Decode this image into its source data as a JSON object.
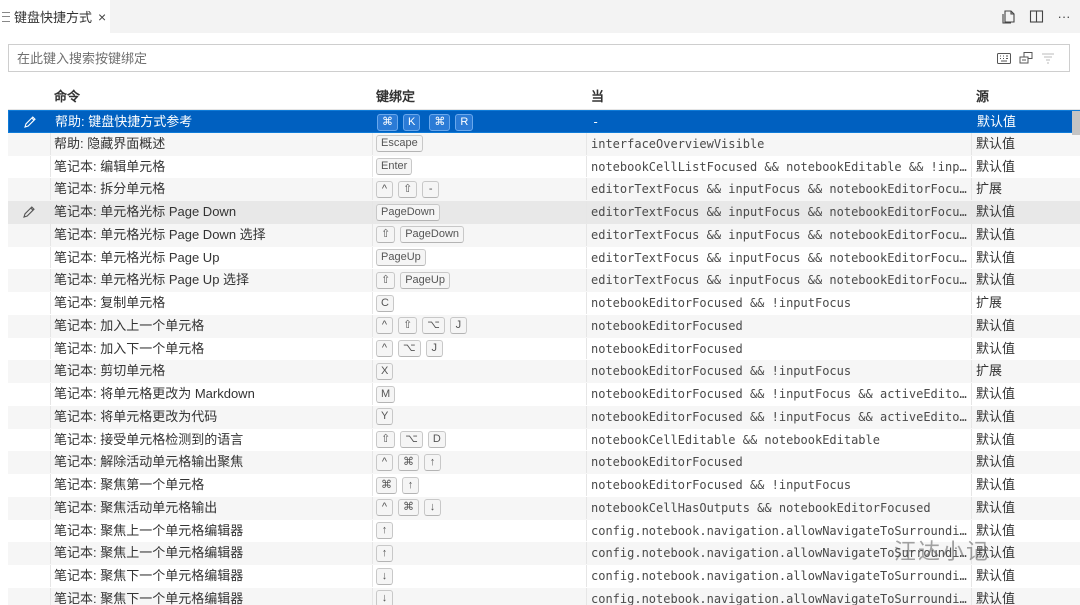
{
  "tab": {
    "title": "键盘快捷方式",
    "close": "×"
  },
  "tab_actions": {
    "more": "···"
  },
  "search": {
    "placeholder": "在此键入搜索按键绑定"
  },
  "columns": {
    "command": "命令",
    "keybinding": "键绑定",
    "when": "当",
    "source": "源"
  },
  "rows": [
    {
      "command": "帮助: 键盘快捷方式参考",
      "keys": [
        "⌘",
        "K",
        "|",
        "⌘",
        "R"
      ],
      "when": "-",
      "source": "默认值",
      "selected": true,
      "edit": true
    },
    {
      "command": "帮助: 隐藏界面概述",
      "keys": [
        "Escape"
      ],
      "when": "interfaceOverviewVisible",
      "source": "默认值"
    },
    {
      "command": "笔记本: 编辑单元格",
      "keys": [
        "Enter"
      ],
      "when": "notebookCellListFocused && notebookEditable && !inputFo…",
      "source": "默认值"
    },
    {
      "command": "笔记本: 拆分单元格",
      "keys": [
        "^",
        "⇧",
        "-"
      ],
      "when": "editorTextFocus && inputFocus && notebookEditorFocused",
      "source": "扩展"
    },
    {
      "command": "笔记本: 单元格光标 Page Down",
      "keys": [
        "PageDown"
      ],
      "when": "editorTextFocus && inputFocus && notebookEditorFocused",
      "source": "默认值",
      "hover": true,
      "edit": true
    },
    {
      "command": "笔记本: 单元格光标 Page Down 选择",
      "keys": [
        "⇧",
        "PageDown"
      ],
      "when": "editorTextFocus && inputFocus && notebookEditorFocused",
      "source": "默认值"
    },
    {
      "command": "笔记本: 单元格光标 Page Up",
      "keys": [
        "PageUp"
      ],
      "when": "editorTextFocus && inputFocus && notebookEditorFocused",
      "source": "默认值"
    },
    {
      "command": "笔记本: 单元格光标 Page Up 选择",
      "keys": [
        "⇧",
        "PageUp"
      ],
      "when": "editorTextFocus && inputFocus && notebookEditorFocused",
      "source": "默认值"
    },
    {
      "command": "笔记本: 复制单元格",
      "keys": [
        "C"
      ],
      "when": "notebookEditorFocused && !inputFocus",
      "source": "扩展"
    },
    {
      "command": "笔记本: 加入上一个单元格",
      "keys": [
        "^",
        "⇧",
        "⌥",
        "J"
      ],
      "when": "notebookEditorFocused",
      "source": "默认值"
    },
    {
      "command": "笔记本: 加入下一个单元格",
      "keys": [
        "^",
        "⌥",
        "J"
      ],
      "when": "notebookEditorFocused",
      "source": "默认值"
    },
    {
      "command": "笔记本: 剪切单元格",
      "keys": [
        "X"
      ],
      "when": "notebookEditorFocused && !inputFocus",
      "source": "扩展"
    },
    {
      "command": "笔记本: 将单元格更改为 Markdown",
      "keys": [
        "M"
      ],
      "when": "notebookEditorFocused && !inputFocus && activeEditor ==…",
      "source": "默认值"
    },
    {
      "command": "笔记本: 将单元格更改为代码",
      "keys": [
        "Y"
      ],
      "when": "notebookEditorFocused && !inputFocus && activeEditor ==…",
      "source": "默认值"
    },
    {
      "command": "笔记本: 接受单元格检测到的语言",
      "keys": [
        "⇧",
        "⌥",
        "D"
      ],
      "when": "notebookCellEditable && notebookEditable",
      "source": "默认值"
    },
    {
      "command": "笔记本: 解除活动单元格输出聚焦",
      "keys": [
        "^",
        "⌘",
        "↑"
      ],
      "when": "notebookEditorFocused",
      "source": "默认值"
    },
    {
      "command": "笔记本: 聚焦第一个单元格",
      "keys": [
        "⌘",
        "↑"
      ],
      "when": "notebookEditorFocused && !inputFocus",
      "source": "默认值"
    },
    {
      "command": "笔记本: 聚焦活动单元格输出",
      "keys": [
        "^",
        "⌘",
        "↓"
      ],
      "when": "notebookCellHasOutputs && notebookEditorFocused",
      "source": "默认值"
    },
    {
      "command": "笔记本: 聚焦上一个单元格编辑器",
      "keys": [
        "↑"
      ],
      "when": "config.notebook.navigation.allowNavigateToSurroundingCe…",
      "source": "默认值"
    },
    {
      "command": "笔记本: 聚焦上一个单元格编辑器",
      "keys": [
        "↑"
      ],
      "when": "config.notebook.navigation.allowNavigateToSurroundingCe…",
      "source": "默认值"
    },
    {
      "command": "笔记本: 聚焦下一个单元格编辑器",
      "keys": [
        "↓"
      ],
      "when": "config.notebook.navigation.allowNavigateToSurroundingCe…",
      "source": "默认值"
    },
    {
      "command": "笔记本: 聚焦下一个单元格编辑器",
      "keys": [
        "↓"
      ],
      "when": "config.notebook.navigation.allowNavigateToSurroundingCe…",
      "source": "默认值"
    }
  ],
  "watermark": "汪达小记",
  "colors": {
    "selection": "#0060c0",
    "alt_row": "#f6f6f6",
    "hover_row": "#e8e8e8"
  }
}
